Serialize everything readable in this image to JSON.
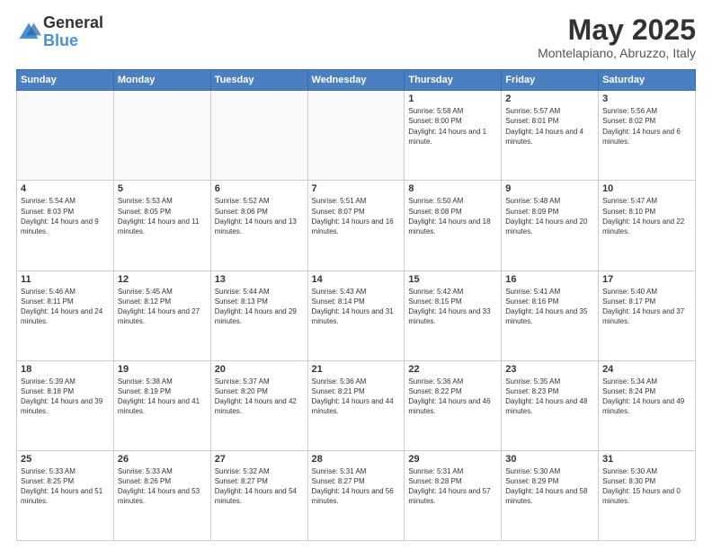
{
  "logo": {
    "general": "General",
    "blue": "Blue"
  },
  "title": {
    "month": "May 2025",
    "location": "Montelapiano, Abruzzo, Italy"
  },
  "days_of_week": [
    "Sunday",
    "Monday",
    "Tuesday",
    "Wednesday",
    "Thursday",
    "Friday",
    "Saturday"
  ],
  "weeks": [
    [
      {
        "day": "",
        "info": ""
      },
      {
        "day": "",
        "info": ""
      },
      {
        "day": "",
        "info": ""
      },
      {
        "day": "",
        "info": ""
      },
      {
        "day": "1",
        "info": "Sunrise: 5:58 AM\nSunset: 8:00 PM\nDaylight: 14 hours and 1 minute."
      },
      {
        "day": "2",
        "info": "Sunrise: 5:57 AM\nSunset: 8:01 PM\nDaylight: 14 hours and 4 minutes."
      },
      {
        "day": "3",
        "info": "Sunrise: 5:56 AM\nSunset: 8:02 PM\nDaylight: 14 hours and 6 minutes."
      }
    ],
    [
      {
        "day": "4",
        "info": "Sunrise: 5:54 AM\nSunset: 8:03 PM\nDaylight: 14 hours and 9 minutes."
      },
      {
        "day": "5",
        "info": "Sunrise: 5:53 AM\nSunset: 8:05 PM\nDaylight: 14 hours and 11 minutes."
      },
      {
        "day": "6",
        "info": "Sunrise: 5:52 AM\nSunset: 8:06 PM\nDaylight: 14 hours and 13 minutes."
      },
      {
        "day": "7",
        "info": "Sunrise: 5:51 AM\nSunset: 8:07 PM\nDaylight: 14 hours and 16 minutes."
      },
      {
        "day": "8",
        "info": "Sunrise: 5:50 AM\nSunset: 8:08 PM\nDaylight: 14 hours and 18 minutes."
      },
      {
        "day": "9",
        "info": "Sunrise: 5:48 AM\nSunset: 8:09 PM\nDaylight: 14 hours and 20 minutes."
      },
      {
        "day": "10",
        "info": "Sunrise: 5:47 AM\nSunset: 8:10 PM\nDaylight: 14 hours and 22 minutes."
      }
    ],
    [
      {
        "day": "11",
        "info": "Sunrise: 5:46 AM\nSunset: 8:11 PM\nDaylight: 14 hours and 24 minutes."
      },
      {
        "day": "12",
        "info": "Sunrise: 5:45 AM\nSunset: 8:12 PM\nDaylight: 14 hours and 27 minutes."
      },
      {
        "day": "13",
        "info": "Sunrise: 5:44 AM\nSunset: 8:13 PM\nDaylight: 14 hours and 29 minutes."
      },
      {
        "day": "14",
        "info": "Sunrise: 5:43 AM\nSunset: 8:14 PM\nDaylight: 14 hours and 31 minutes."
      },
      {
        "day": "15",
        "info": "Sunrise: 5:42 AM\nSunset: 8:15 PM\nDaylight: 14 hours and 33 minutes."
      },
      {
        "day": "16",
        "info": "Sunrise: 5:41 AM\nSunset: 8:16 PM\nDaylight: 14 hours and 35 minutes."
      },
      {
        "day": "17",
        "info": "Sunrise: 5:40 AM\nSunset: 8:17 PM\nDaylight: 14 hours and 37 minutes."
      }
    ],
    [
      {
        "day": "18",
        "info": "Sunrise: 5:39 AM\nSunset: 8:18 PM\nDaylight: 14 hours and 39 minutes."
      },
      {
        "day": "19",
        "info": "Sunrise: 5:38 AM\nSunset: 8:19 PM\nDaylight: 14 hours and 41 minutes."
      },
      {
        "day": "20",
        "info": "Sunrise: 5:37 AM\nSunset: 8:20 PM\nDaylight: 14 hours and 42 minutes."
      },
      {
        "day": "21",
        "info": "Sunrise: 5:36 AM\nSunset: 8:21 PM\nDaylight: 14 hours and 44 minutes."
      },
      {
        "day": "22",
        "info": "Sunrise: 5:36 AM\nSunset: 8:22 PM\nDaylight: 14 hours and 46 minutes."
      },
      {
        "day": "23",
        "info": "Sunrise: 5:35 AM\nSunset: 8:23 PM\nDaylight: 14 hours and 48 minutes."
      },
      {
        "day": "24",
        "info": "Sunrise: 5:34 AM\nSunset: 8:24 PM\nDaylight: 14 hours and 49 minutes."
      }
    ],
    [
      {
        "day": "25",
        "info": "Sunrise: 5:33 AM\nSunset: 8:25 PM\nDaylight: 14 hours and 51 minutes."
      },
      {
        "day": "26",
        "info": "Sunrise: 5:33 AM\nSunset: 8:26 PM\nDaylight: 14 hours and 53 minutes."
      },
      {
        "day": "27",
        "info": "Sunrise: 5:32 AM\nSunset: 8:27 PM\nDaylight: 14 hours and 54 minutes."
      },
      {
        "day": "28",
        "info": "Sunrise: 5:31 AM\nSunset: 8:27 PM\nDaylight: 14 hours and 56 minutes."
      },
      {
        "day": "29",
        "info": "Sunrise: 5:31 AM\nSunset: 8:28 PM\nDaylight: 14 hours and 57 minutes."
      },
      {
        "day": "30",
        "info": "Sunrise: 5:30 AM\nSunset: 8:29 PM\nDaylight: 14 hours and 58 minutes."
      },
      {
        "day": "31",
        "info": "Sunrise: 5:30 AM\nSunset: 8:30 PM\nDaylight: 15 hours and 0 minutes."
      }
    ]
  ]
}
